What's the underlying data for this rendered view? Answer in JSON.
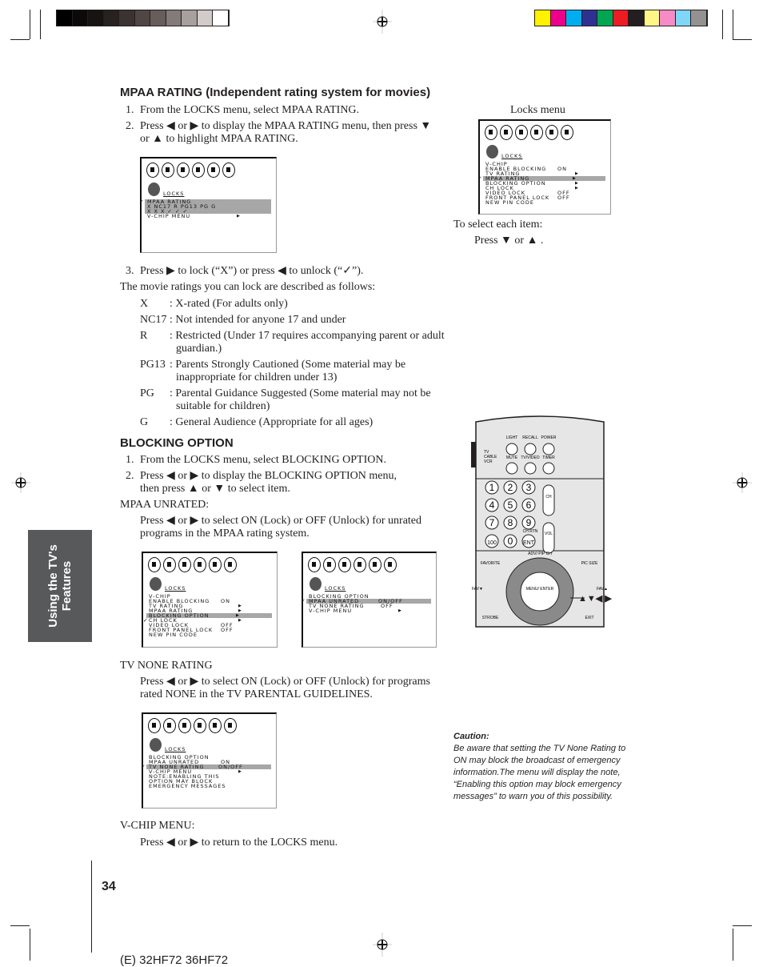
{
  "colors": {
    "grayscale": [
      "#000000",
      "#0b0a09",
      "#161312",
      "#272220",
      "#3b3331",
      "#504644",
      "#675d5b",
      "#837b79",
      "#a8a09e",
      "#d1cbc9",
      "#ffffff"
    ],
    "process": [
      "#fff200",
      "#ec008c",
      "#00aeef",
      "#2e3192",
      "#00a651",
      "#ed1c24",
      "#231f20",
      "#fff685",
      "#f68bc6",
      "#7fd6f7",
      "#939191"
    ],
    "sidebar": "#58595b",
    "menu_highlight": "#a7a7a7"
  },
  "sidebar_tab": {
    "line1": "Using the TV's",
    "line2": "Features"
  },
  "mpaa": {
    "heading": "MPAA RATING (Independent rating system for movies)",
    "steps": [
      {
        "n": "1.",
        "lines": [
          "From the LOCKS menu, select MPAA RATING."
        ]
      },
      {
        "n": "2.",
        "lines": [
          "Press ◀ or ▶ to display the MPAA RATING menu, then press ▼",
          "or ▲ to highlight MPAA RATING."
        ]
      },
      {
        "n": "3.",
        "lines": [
          "Press ▶ to lock (“X”) or press ◀ to unlock (“✓”)."
        ]
      }
    ],
    "intro": "The movie ratings you can lock are described as follows:",
    "ratings": [
      {
        "code": "X",
        "lines": [
          ": X-rated (For adults only)"
        ]
      },
      {
        "code": "NC17",
        "lines": [
          ": Not intended for anyone 17 and under"
        ]
      },
      {
        "code": "R",
        "lines": [
          ": Restricted (Under 17 requires accompanying parent or adult",
          "guardian.)"
        ]
      },
      {
        "code": "PG13",
        "lines": [
          ": Parents Strongly Cautioned (Some material may be",
          "inappropriate for children under 13)"
        ]
      },
      {
        "code": "PG",
        "lines": [
          ": Parental Guidance Suggested (Some material may not be",
          "suitable for children)"
        ]
      },
      {
        "code": "G",
        "lines": [
          ": General Audience (Appropriate for all ages)"
        ]
      }
    ]
  },
  "blocking": {
    "heading": "BLOCKING OPTION",
    "steps": [
      {
        "n": "1.",
        "lines": [
          "From the LOCKS menu, select BLOCKING OPTION."
        ]
      },
      {
        "n": "2.",
        "lines": [
          "Press ◀ or ▶ to display the BLOCKING OPTION menu,",
          "then press ▲ or ▼ to select item."
        ]
      }
    ],
    "mpaa_unrated_label": "MPAA UNRATED:",
    "mpaa_unrated_text": [
      "Press ◀ or ▶ to select ON (Lock) or OFF (Unlock) for unrated",
      "programs in the MPAA rating system."
    ],
    "tv_none_label": "TV NONE RATING",
    "tv_none_text": [
      "Press ◀ or ▶ to select ON (Lock) or OFF (Unlock) for programs",
      "rated NONE in the TV PARENTAL GUIDELINES."
    ],
    "vchip_label": "V-CHIP MENU:",
    "vchip_text": "Press ◀ or ▶ to return to the LOCKS menu."
  },
  "right": {
    "locks_menu_caption": "Locks menu",
    "select_each": "To select each item:",
    "press_select": "Press ▼ or ▲ .",
    "remote_callout": "▲▼◀ ▶",
    "caution_title": "Caution:",
    "caution_text": "Be aware that setting the TV None Rating to ON may block the broadcast of emergency information.The menu will display the note, “Enabling this option may block emergency messages” to warn you of this possibility."
  },
  "remote": {
    "labels": [
      "LIGHT",
      "RECALL",
      "POWER",
      "MUTE",
      "TV/VIDEO",
      "TIMER",
      "TV",
      "CABLE",
      "VCR",
      "CH",
      "VOL",
      "CH RTN",
      "ADV/ PIP CH",
      "FAV▼",
      "FAV▲",
      "MENU/ ENTER",
      "FAVORITE",
      "PIC SIZE",
      "STROBE",
      "EXIT"
    ],
    "keys": [
      "1",
      "2",
      "3",
      "4",
      "5",
      "6",
      "7",
      "8",
      "9",
      "100",
      "0",
      "ENT"
    ]
  },
  "menus": [
    {
      "title": "LOCKS",
      "lines": [
        {
          "t": "MPAA RATING",
          "hl": true,
          "check": true
        },
        {
          "t": " X  NC17  R  PG13  PG  G",
          "hl": true
        },
        {
          "t": " X   X    X    ✓    ✓   ✓",
          "hl": true
        },
        {
          "t": "V-CHIP MENU",
          "arrow": true
        }
      ]
    },
    {
      "title": "LOCKS",
      "lines": [
        {
          "t": "V-CHIP"
        },
        {
          "t": " ENABLE BLOCKING",
          "v": "ON"
        },
        {
          "t": " TV RATING",
          "arrow": true
        },
        {
          "t": " MPAA RATING",
          "arrow": true,
          "hl": true,
          "check": true
        },
        {
          "t": " BLOCKING OPTION",
          "arrow": true
        },
        {
          "t": "CH LOCK",
          "arrow": true
        },
        {
          "t": "VIDEO LOCK",
          "v": "OFF"
        },
        {
          "t": "FRONT PANEL LOCK",
          "v": "OFF"
        },
        {
          "t": "NEW PIN CODE"
        }
      ]
    },
    {
      "title": "LOCKS",
      "lines": [
        {
          "t": "V-CHIP"
        },
        {
          "t": " ENABLE BLOCKING",
          "v": "ON"
        },
        {
          "t": " TV RATING",
          "arrow": true
        },
        {
          "t": " MPAA RATING",
          "arrow": true
        },
        {
          "t": " BLOCKING OPTION",
          "arrow": true,
          "hl": true
        },
        {
          "t": "CH LOCK",
          "arrow": true,
          "check": true
        },
        {
          "t": "VIDEO LOCK",
          "v": "OFF"
        },
        {
          "t": "FRONT PANEL LOCK",
          "v": "OFF"
        },
        {
          "t": "NEW PIN CODE"
        }
      ]
    },
    {
      "title": "LOCKS",
      "lines": [
        {
          "t": "BLOCKING OPTION"
        },
        {
          "t": " MPAA UNRATED",
          "v": "ON/OFF",
          "hl": true,
          "check": true
        },
        {
          "t": " TV NONE RATING",
          "v": "OFF"
        },
        {
          "t": "V-CHIP MENU",
          "arrow": true
        }
      ]
    },
    {
      "title": "LOCKS",
      "lines": [
        {
          "t": "BLOCKING OPTION"
        },
        {
          "t": " MPAA UNRATED",
          "v": "ON"
        },
        {
          "t": " TV NONE RATING",
          "v": "ON/OFF",
          "hl": true,
          "check": true
        },
        {
          "t": "V-CHIP MENU",
          "arrow": true
        },
        {
          "t": "NOTE:ENABLING THIS"
        },
        {
          "t": " OPTION MAY BLOCK"
        },
        {
          "t": " EMERGENCY MESSAGES"
        }
      ]
    }
  ],
  "footer": {
    "page_number": "34",
    "model": "(E) 32HF72  36HF72"
  }
}
